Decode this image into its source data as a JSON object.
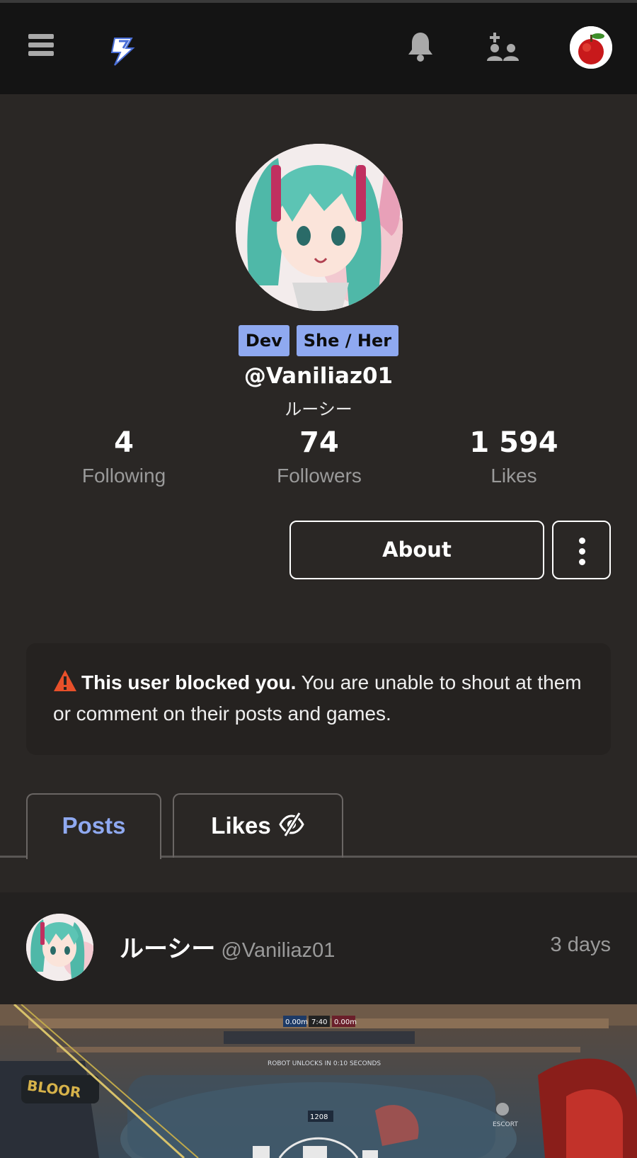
{
  "topbar": {
    "icons": [
      "menu-icon",
      "lightning-logo-icon",
      "bell-icon",
      "add-user-icon",
      "apple-avatar"
    ]
  },
  "profile": {
    "badges": [
      "Dev",
      "She / Her"
    ],
    "handle": "@Vaniliaz01",
    "display_name": "ルーシー",
    "stats": [
      {
        "value": "4",
        "label": "Following"
      },
      {
        "value": "74",
        "label": "Followers"
      },
      {
        "value": "1 594",
        "label": "Likes"
      }
    ],
    "about_label": "About"
  },
  "blocked_notice": {
    "bold": "This user blocked you.",
    "text": " You are unable to shout at them or comment on their posts and games."
  },
  "tabs": [
    {
      "label": "Posts",
      "active": true
    },
    {
      "label": "Likes",
      "active": false,
      "icon": "eye-off-icon"
    }
  ],
  "post": {
    "author_name": "ルーシー",
    "author_handle": "@Vaniliaz01",
    "time": "3 days",
    "image_text": {
      "score_left": "0.00m",
      "timer": "7:40",
      "score_right": "0.00m",
      "banner": "ROBOT UNLOCKS IN 0:10 SECONDS",
      "team_sign": "BLOOR",
      "counter": "1208",
      "escort": "ESCORT"
    }
  },
  "colors": {
    "accent": "#8fa9f0",
    "background": "#2a2725",
    "topbar": "#141414",
    "warning": "#e8502a"
  }
}
